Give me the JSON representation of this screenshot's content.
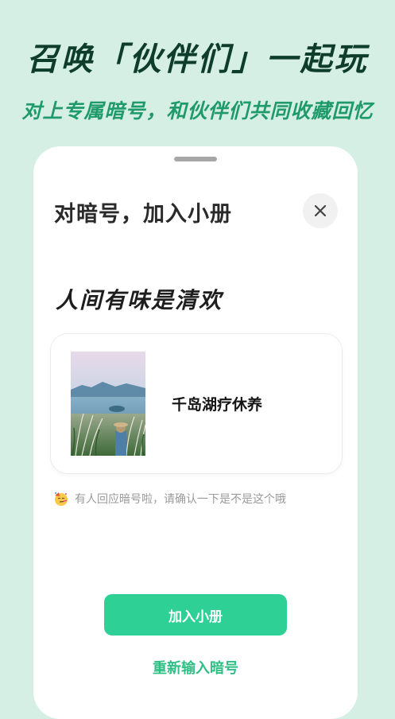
{
  "promo": {
    "headline": "召唤「伙伴们」一起玩",
    "subheadline": "对上专属暗号，和伙伴们共同收藏回忆"
  },
  "dialog": {
    "title": "对暗号，加入小册",
    "close_icon": "close-icon",
    "secret_code": "人间有味是清欢",
    "album": {
      "name": "千岛湖疗休养",
      "cover": "album-cover-photo"
    },
    "notice": {
      "emoji": "party-face-emoji",
      "text": "有人回应暗号啦，请确认一下是不是这个哦"
    },
    "primary_button": "加入小册",
    "secondary_link": "重新输入暗号"
  },
  "colors": {
    "background": "#d6efe5",
    "headline": "#0f3d2c",
    "accent": "#2fd095",
    "accent_text": "#2fbf85"
  }
}
